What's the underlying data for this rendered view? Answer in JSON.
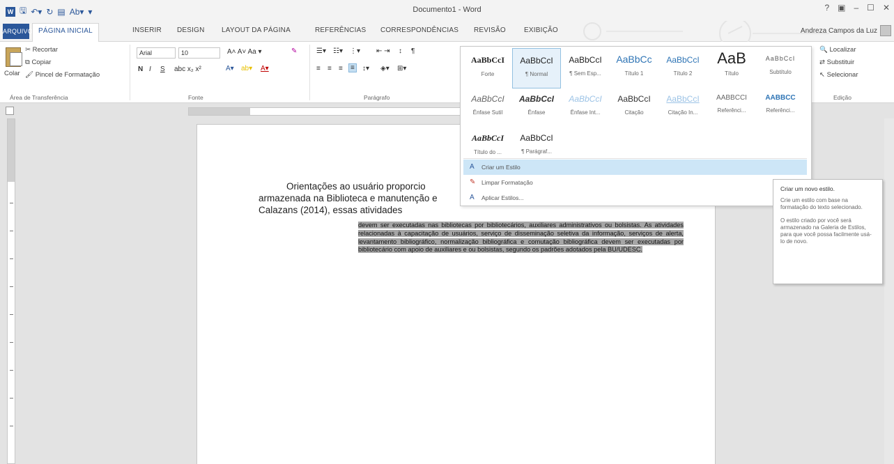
{
  "window": {
    "title": "Documento1 - Word",
    "controls": [
      "?",
      "▣",
      "–",
      "☐",
      "✕"
    ]
  },
  "quick_access": {
    "save_icon": "save-icon",
    "undo_icon": "undo-icon",
    "redo_icon": "redo-icon"
  },
  "tabs": {
    "file": "ARQUIVO",
    "items": [
      "PÁGINA INICIAL",
      "INSERIR",
      "DESIGN",
      "LAYOUT DA PÁGINA",
      "REFERÊNCIAS",
      "CORRESPONDÊNCIAS",
      "REVISÃO",
      "EXIBIÇÃO"
    ],
    "active": "PÁGINA INICIAL"
  },
  "user": {
    "name": "Andreza Campos da Luz"
  },
  "ribbon": {
    "clipboard": {
      "paste": "Colar",
      "cut": "Recortar",
      "copy": "Copiar",
      "format_painter": "Pincel de Formatação",
      "label": "Área de Transferência"
    },
    "font": {
      "name": "Arial",
      "size": "10",
      "label": "Fonte",
      "bold": "N",
      "italic": "I",
      "underline": "S",
      "row1_extra": "A˄ A˅  Aa ▾",
      "row2_extra": "abc x₂ x²"
    },
    "paragraph": {
      "label": "Parágrafo"
    },
    "styles": {
      "row1": [
        {
          "sample": "AaBbCcI",
          "name": "Forte"
        },
        {
          "sample": "AaBbCcI",
          "name": "¶ Normal"
        },
        {
          "sample": "AaBbCcI",
          "name": "¶ Sem Esp..."
        },
        {
          "sample": "AaBbCc",
          "name": "Título 1"
        },
        {
          "sample": "AaBbCcI",
          "name": "Título 2"
        },
        {
          "sample": "AaB",
          "name": "Título"
        },
        {
          "sample": "AaBbCcI",
          "name": "Subtítulo"
        }
      ],
      "row2": [
        {
          "sample": "AaBbCcI",
          "name": "Ênfase Sutil"
        },
        {
          "sample": "AaBbCcI",
          "name": "Ênfase"
        },
        {
          "sample": "AaBbCcI",
          "name": "Ênfase Int..."
        },
        {
          "sample": "AaBbCcI",
          "name": "Citação"
        },
        {
          "sample": "AaBbCcI",
          "name": "Citação In..."
        },
        {
          "sample": "AABBCCI",
          "name": "Referênci..."
        },
        {
          "sample": "AABBCC",
          "name": "Referênci..."
        }
      ],
      "row3": [
        {
          "sample": "AaBbCcI",
          "name": "Título do ..."
        },
        {
          "sample": "AaBbCcI",
          "name": "¶ Parágraf..."
        }
      ]
    },
    "editing": {
      "find": "Localizar",
      "replace": "Substituir",
      "select": "Selecionar",
      "label": "Edição"
    }
  },
  "gallery_menu": {
    "create_style": "Criar um Estilo",
    "clear_formatting": "Limpar Formatação",
    "apply_styles": "Aplicar Estilos..."
  },
  "tooltip": {
    "title": "Criar um novo estilo.",
    "p1": "Crie um estilo com base na formatação do texto selecionado.",
    "p2": "O estilo criado por você será armazenado na Galeria de Estilos, para que você possa facilmente usá-lo de novo."
  },
  "document": {
    "para_line1": "Orientações ao usuário proporcio",
    "para_line2": "armazenada na Biblioteca e manutenção e",
    "para_line3": "Calazans (2014), essas atividades",
    "quote": "devem ser executadas nas bibliotecas por bibliotecários, auxiliares administrativos ou bolsistas. As atividades relacionadas à capacitação de usuários, serviço de disseminação seletiva da informação, serviços de alerta, levantamento bibliográfico, normalização bibliográfica e comutação bibliográfica devem ser executadas por bibliotecário com apoio de auxiliares e ou bolsistas, segundo os padrões adotados pela BU/UDESC."
  },
  "colors": {
    "accent": "#2b579a",
    "selection": "#a6a6a6",
    "hover": "#cde6f7"
  }
}
